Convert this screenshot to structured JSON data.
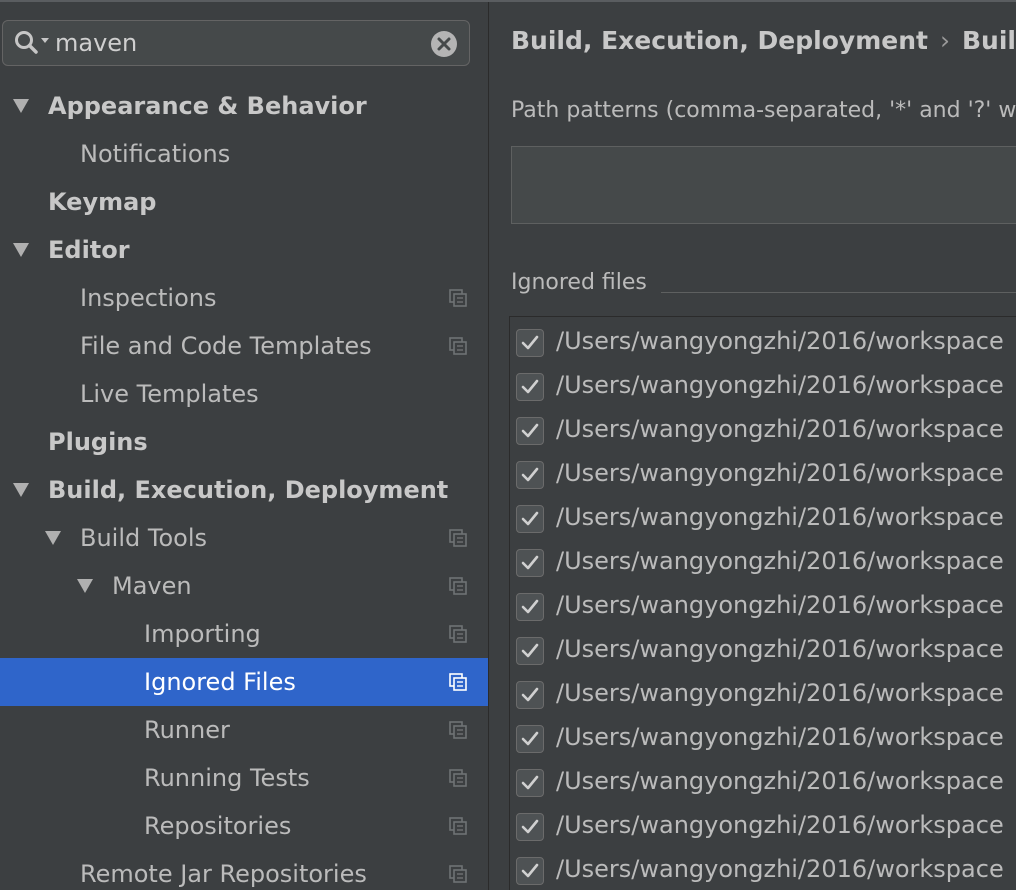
{
  "search": {
    "value": "maven",
    "placeholder": ""
  },
  "tree": [
    {
      "label": "Appearance & Behavior",
      "level": 0,
      "bold": true,
      "arrow": true,
      "copy": false,
      "selected": false
    },
    {
      "label": "Notifications",
      "level": 1,
      "bold": false,
      "arrow": false,
      "copy": false,
      "selected": false
    },
    {
      "label": "Keymap",
      "level": 0,
      "bold": true,
      "arrow": false,
      "copy": false,
      "selected": false
    },
    {
      "label": "Editor",
      "level": 0,
      "bold": true,
      "arrow": true,
      "copy": false,
      "selected": false
    },
    {
      "label": "Inspections",
      "level": 1,
      "bold": false,
      "arrow": false,
      "copy": true,
      "selected": false
    },
    {
      "label": "File and Code Templates",
      "level": 1,
      "bold": false,
      "arrow": false,
      "copy": true,
      "selected": false
    },
    {
      "label": "Live Templates",
      "level": 1,
      "bold": false,
      "arrow": false,
      "copy": false,
      "selected": false
    },
    {
      "label": "Plugins",
      "level": 0,
      "bold": true,
      "arrow": false,
      "copy": false,
      "selected": false
    },
    {
      "label": "Build, Execution, Deployment",
      "level": 0,
      "bold": true,
      "arrow": true,
      "copy": false,
      "selected": false
    },
    {
      "label": "Build Tools",
      "level": 1,
      "bold": false,
      "arrow": true,
      "copy": true,
      "selected": false
    },
    {
      "label": "Maven",
      "level": 2,
      "bold": false,
      "arrow": true,
      "copy": true,
      "selected": false
    },
    {
      "label": "Importing",
      "level": 3,
      "bold": false,
      "arrow": false,
      "copy": true,
      "selected": false
    },
    {
      "label": "Ignored Files",
      "level": 3,
      "bold": false,
      "arrow": false,
      "copy": true,
      "selected": true
    },
    {
      "label": "Runner",
      "level": 3,
      "bold": false,
      "arrow": false,
      "copy": true,
      "selected": false
    },
    {
      "label": "Running Tests",
      "level": 3,
      "bold": false,
      "arrow": false,
      "copy": true,
      "selected": false
    },
    {
      "label": "Repositories",
      "level": 3,
      "bold": false,
      "arrow": false,
      "copy": true,
      "selected": false
    },
    {
      "label": "Remote Jar Repositories",
      "level": 1,
      "bold": false,
      "arrow": false,
      "copy": true,
      "selected": false
    }
  ],
  "main": {
    "breadcrumb": [
      "Build, Execution, Deployment",
      "Build"
    ],
    "breadcrumb_sep": "›",
    "path_patterns_label": "Path patterns (comma-separated, '*' and '?' w",
    "ignored_files_label": "Ignored files",
    "files": [
      {
        "path": "/Users/wangyongzhi/2016/workspace",
        "checked": true
      },
      {
        "path": "/Users/wangyongzhi/2016/workspace",
        "checked": true
      },
      {
        "path": "/Users/wangyongzhi/2016/workspace",
        "checked": true
      },
      {
        "path": "/Users/wangyongzhi/2016/workspace",
        "checked": true
      },
      {
        "path": "/Users/wangyongzhi/2016/workspace",
        "checked": true
      },
      {
        "path": "/Users/wangyongzhi/2016/workspace",
        "checked": true
      },
      {
        "path": "/Users/wangyongzhi/2016/workspace",
        "checked": true
      },
      {
        "path": "/Users/wangyongzhi/2016/workspace",
        "checked": true
      },
      {
        "path": "/Users/wangyongzhi/2016/workspace",
        "checked": true
      },
      {
        "path": "/Users/wangyongzhi/2016/workspace",
        "checked": true
      },
      {
        "path": "/Users/wangyongzhi/2016/workspace",
        "checked": true
      },
      {
        "path": "/Users/wangyongzhi/2016/workspace",
        "checked": true
      },
      {
        "path": "/Users/wangyongzhi/2016/workspace",
        "checked": true
      }
    ]
  },
  "colors": {
    "background": "#3c3f41",
    "selection": "#2f65ca",
    "text": "#bbbbbb"
  },
  "icons": {
    "search": "search-icon",
    "clear": "clear-icon",
    "copy": "copy-settings-icon",
    "expand": "triangle-down-icon",
    "check": "check-icon"
  }
}
